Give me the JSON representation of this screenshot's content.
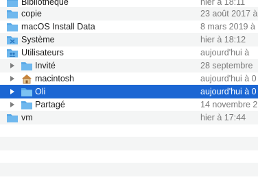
{
  "rows": [
    {
      "name": "Bibliothèque",
      "date": "hier à 18:11",
      "icon": "folder-icon"
    },
    {
      "name": "copie",
      "date": "23 août 2017 à",
      "icon": "folder-icon"
    },
    {
      "name": "macOS Install Data",
      "date": "8 mars 2019 à",
      "icon": "folder-icon"
    },
    {
      "name": "Système",
      "date": "hier à 18:12",
      "icon": "system-folder-icon"
    },
    {
      "name": "Utilisateurs",
      "date": "aujourd'hui à",
      "icon": "users-folder-icon",
      "expanded": true
    },
    {
      "name": "Invité",
      "date": "28 septembre",
      "icon": "folder-icon"
    },
    {
      "name": "macintosh",
      "date": "aujourd'hui à 0",
      "icon": "home-folder-icon"
    },
    {
      "name": "Oli",
      "date": "aujourd'hui à 0",
      "icon": "folder-icon",
      "selected": true
    },
    {
      "name": "Partagé",
      "date": "14 novembre 2",
      "icon": "folder-icon"
    },
    {
      "name": "vm",
      "date": "hier à 17:44",
      "icon": "folder-icon"
    }
  ],
  "colors": {
    "selection": "#1b66d3",
    "folder": "#5aa9e6",
    "date_text": "#7a7a7a",
    "stripe": "#f4f5f5"
  }
}
